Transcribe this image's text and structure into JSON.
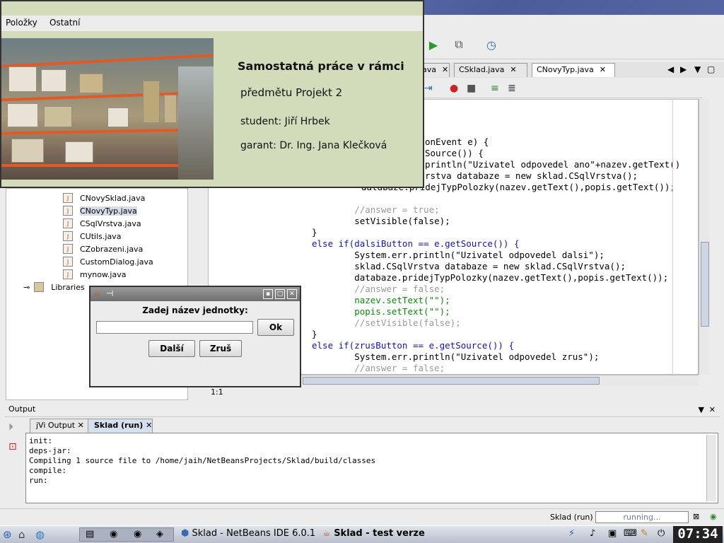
{
  "taskbar_windows": {
    "ide_title": "Sklad - NetBeans IDE 6.0.1",
    "app_title": "Sklad - test verze"
  },
  "about": {
    "menu": [
      "Položky",
      "Ostatní"
    ],
    "heading": "Samostatná práce v rámci",
    "line2": "předmětu Projekt 2",
    "student": "student: Jiří Hrbek",
    "garant": "garant: Dr. Ing. Jana Klečková"
  },
  "editor_tabs": [
    {
      "label": "ava"
    },
    {
      "label": "CSklad.java"
    },
    {
      "label": "CNovyTyp.java"
    }
  ],
  "project_tree": [
    {
      "label": "CNovySklad.java"
    },
    {
      "label": "CNovyTyp.java"
    },
    {
      "label": "CSqlVrstva.java"
    },
    {
      "label": "CUtils.java"
    },
    {
      "label": "CZobrazeni.java"
    },
    {
      "label": "CustomDialog.java"
    },
    {
      "label": "mynow.java"
    },
    {
      "label": "Libraries"
    }
  ],
  "code": [
    "onEvent e) {",
    "Source()) {",
    "println(\"Uzivatel odpovedel ano\"+nazev.getText()",
    "rstva databaze = new sklad.CSqlVrstva();",
    "databaze.pridejTypPolozky(nazev.getText(),popis.getText());",
    "",
    "        //answer = true;",
    "        setVisible(false);",
    "}",
    "else if(dalsiButton == e.getSource()) {",
    "        System.err.println(\"Uzivatel odpovedel dalsi\");",
    "        sklad.CSqlVrstva databaze = new sklad.CSqlVrstva();",
    "        databaze.pridejTypPolozky(nazev.getText(),popis.getText());",
    "        //answer = false;",
    "        nazev.setText(\"\");",
    "        popis.setText(\"\");",
    "        //setVisible(false);",
    "}",
    "else if(zrusButton == e.getSource()) {",
    "        System.err.println(\"Uzivatel odpovedel zrus\");",
    "        //answer = false;"
  ],
  "cursor_pos": "1:1",
  "output": {
    "title": "Output",
    "tabs": [
      "jVi Output",
      "Sklad (run)"
    ],
    "lines": [
      "init:",
      "deps-jar:",
      "Compiling 1 source file to /home/jaih/NetBeansProjects/Sklad/build/classes",
      "compile:",
      "run:"
    ]
  },
  "status": {
    "project": "Sklad (run)",
    "progress_label": "running..."
  },
  "dialog": {
    "prompt": "Zadej název jednotky:",
    "input_value": "",
    "ok": "Ok",
    "next": "Další",
    "cancel": "Zruš"
  },
  "clock": "07:34"
}
